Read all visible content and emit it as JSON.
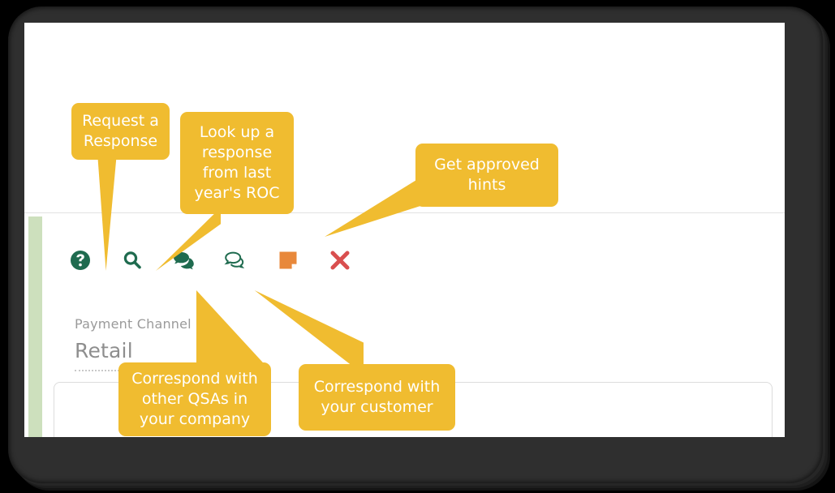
{
  "theme": {
    "callout_bg": "#f0bc30",
    "callout_text": "#ffffff",
    "icon_green": "#1f6b4f",
    "icon_orange": "#e8883a",
    "icon_red": "#d94f4f",
    "accent_strip": "#cde0bd",
    "page_bg": "#ffffff",
    "bezel": "#2f2f2f"
  },
  "toolbar": {
    "items": [
      {
        "name": "request-response-icon",
        "icon": "question-circle-icon",
        "label": "Request a Response"
      },
      {
        "name": "lookup-response-icon",
        "icon": "search-icon",
        "label": "Look up a response from last year's ROC"
      },
      {
        "name": "internal-chat-icon",
        "icon": "chat-bubbles-filled-icon",
        "label": "Correspond with other QSAs in your company"
      },
      {
        "name": "customer-chat-icon",
        "icon": "chat-bubbles-outline-icon",
        "label": "Correspond with your customer"
      },
      {
        "name": "note-icon",
        "icon": "sticky-note-icon",
        "label": "Note"
      },
      {
        "name": "delete-icon",
        "icon": "close-x-icon",
        "label": "Delete"
      }
    ]
  },
  "field": {
    "label": "Payment Channel",
    "value": "Retail"
  },
  "response_box": {
    "value": "",
    "placeholder": ""
  },
  "callouts": [
    {
      "id": "request-a-response",
      "text": "Request a Response"
    },
    {
      "id": "look-up-a-response",
      "text": "Look up a response from last year's ROC"
    },
    {
      "id": "get-approved-hints",
      "text": "Get approved hints"
    },
    {
      "id": "correspond-with-qsas",
      "text": "Correspond with other QSAs in your company"
    },
    {
      "id": "correspond-with-customer",
      "text": "Correspond with your customer"
    }
  ]
}
